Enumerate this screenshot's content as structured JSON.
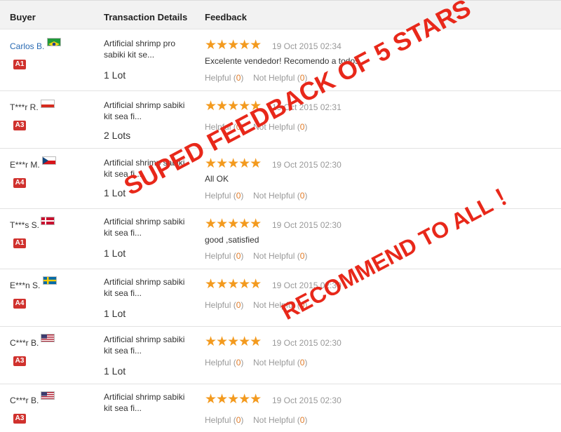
{
  "header": {
    "buyer": "Buyer",
    "transaction": "Transaction Details",
    "feedback": "Feedback"
  },
  "stars_glyph": "★★★★★",
  "helpful_label": "Helpful (",
  "not_helpful_label": "Not Helpful (",
  "close_paren": ")",
  "rows": [
    {
      "buyer": "Carlos B.",
      "flag": "brazil-flag",
      "badge": "A1",
      "product1": "Artificial shrimp pro",
      "product2": "sabiki kit se...",
      "lots": "1 Lot",
      "date": "19 Oct 2015 02:34",
      "comment": "Excelente vendedor! Recomendo a todos.",
      "helpful": "0",
      "not_helpful": "0"
    },
    {
      "buyer": "T***r R.",
      "flag": "gibraltar-flag",
      "badge": "A3",
      "product1": "Artificial shrimp sabiki",
      "product2": "kit sea fi...",
      "lots": "2 Lots",
      "date": "19 Oct 2015 02:31",
      "comment": "",
      "helpful": "0",
      "not_helpful": "0"
    },
    {
      "buyer": "E***r M.",
      "flag": "czech-flag",
      "badge": "A4",
      "product1": "Artificial shrimp sabiki",
      "product2": "kit sea fi...",
      "lots": "1 Lot",
      "date": "19 Oct 2015 02:30",
      "comment": "All OK",
      "helpful": "0",
      "not_helpful": "0"
    },
    {
      "buyer": "T***s S.",
      "flag": "denmark-flag",
      "badge": "A1",
      "product1": "Artificial shrimp sabiki",
      "product2": "kit sea fi...",
      "lots": "1 Lot",
      "date": "19 Oct 2015 02:30",
      "comment": "good ,satisfied",
      "helpful": "0",
      "not_helpful": "0"
    },
    {
      "buyer": "E***n S.",
      "flag": "sweden-flag",
      "badge": "A4",
      "product1": "Artificial shrimp sabiki",
      "product2": "kit sea fi...",
      "lots": "1 Lot",
      "date": "19 Oct 2015 02:30",
      "comment": "",
      "helpful": "0",
      "not_helpful": "0"
    },
    {
      "buyer": "C***r B.",
      "flag": "usa-flag",
      "badge": "A3",
      "product1": "Artificial shrimp sabiki",
      "product2": "kit sea fi...",
      "lots": "1 Lot",
      "date": "19 Oct 2015 02:30",
      "comment": "",
      "helpful": "0",
      "not_helpful": "0"
    },
    {
      "buyer": "C***r B.",
      "flag": "usa-flag",
      "badge": "A3",
      "product1": "Artificial shrimp sabiki",
      "product2": "kit sea fi...",
      "lots": "",
      "date": "19 Oct 2015 02:30",
      "comment": "",
      "helpful": "0",
      "not_helpful": "0"
    }
  ],
  "overlay": {
    "line1": "SUPED FEEDBACK OF 5 STARS",
    "line2": "RECOMMEND TO ALL ！"
  },
  "colors": {
    "star": "#f39a1e",
    "badge": "#d0312d",
    "overlay": "#e8281a",
    "link": "#2a6bb3"
  }
}
